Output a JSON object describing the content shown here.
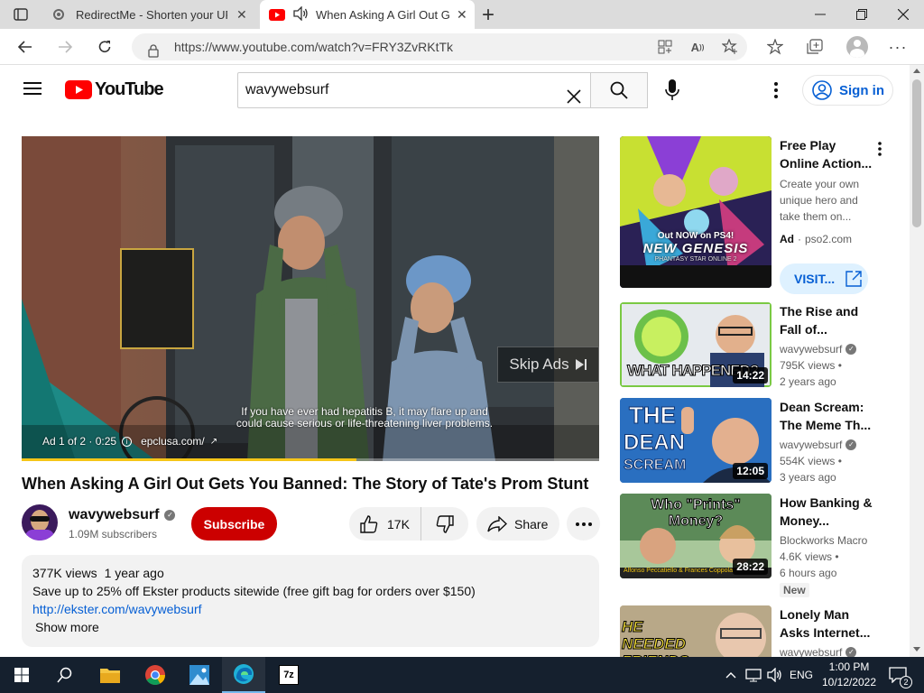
{
  "browser": {
    "tabs": [
      {
        "title": "RedirectMe - Shorten your URL f"
      },
      {
        "title": "When Asking A Girl Out Get"
      }
    ],
    "new_tab": "+",
    "url": "https://www.youtube.com/watch?v=FRY3ZvRKtTk"
  },
  "yt": {
    "logo_text": "YouTube",
    "search_value": "wavywebsurf",
    "signin_label": "Sign in"
  },
  "player": {
    "skip_label": "Skip Ads",
    "caption_line1": "If you have ever had hepatitis B, it may flare up and",
    "caption_line2": "could cause serious or life-threatening liver problems.",
    "ad_info": "Ad 1 of 2 · 0:25",
    "ad_domain": "epclusa.com/",
    "progress": 0.58,
    "progress_color": "#f5c518"
  },
  "video": {
    "title": "When Asking A Girl Out Gets You Banned: The Story of Tate's Prom Stunt",
    "channel": "wavywebsurf",
    "subscribers": "1.09M subscribers",
    "subscribe_label": "Subscribe",
    "likes": "17K",
    "share_label": "Share",
    "views": "377K views",
    "age": "1 year ago",
    "description": "Save up to 25% off Ekster products sitewide (free gift bag for orders over $150)",
    "link": "http://ekster.com/wavywebsurf",
    "show_more": "Show more"
  },
  "sidebar": {
    "ad": {
      "title": "Free Play Online Action...",
      "description": "Create your own unique hero and take them on...",
      "ad_label": "Ad",
      "domain": "pso2.com",
      "visit_label": "VISIT...",
      "thumb_text_1": "Out NOW on PS4!",
      "thumb_text_2": "NEW GENESIS",
      "thumb_text_3": "PHANTASY STAR ONLINE 2"
    },
    "videos": [
      {
        "title": "The Rise and Fall of...",
        "channel": "wavywebsurf",
        "views": "795K views •",
        "age": "2 years ago",
        "duration": "14:22",
        "thumb_text": "WHAT HAPPENED?"
      },
      {
        "title": "Dean Scream: The Meme Th...",
        "channel": "wavywebsurf",
        "views": "554K views •",
        "age": "3 years ago",
        "duration": "12:05",
        "thumb_text_1": "THE",
        "thumb_text_2": "DEAN",
        "thumb_text_3": "SCREAM"
      },
      {
        "title": "How Banking & Money...",
        "channel": "Blockworks Macro",
        "views": "4.6K views •",
        "age": "6 hours ago",
        "duration": "28:22",
        "badge": "New",
        "thumb_text_1": "Who \"Prints\"",
        "thumb_text_2": "Money?",
        "thumb_caption": "Alfonso Peccatiello & Frances Coppola"
      },
      {
        "title": "Lonely Man Asks Internet...",
        "channel": "wavywebsurf",
        "thumb_text": "HE NEEDED FRIENDS..."
      }
    ]
  },
  "taskbar": {
    "language": "ENG",
    "time": "1:00 PM",
    "date": "10/12/2022",
    "notifications": "2"
  }
}
